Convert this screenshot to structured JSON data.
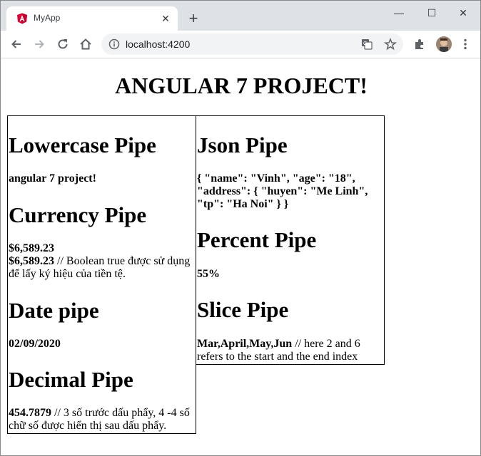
{
  "browser": {
    "tab_title": "MyApp",
    "url": "localhost:4200",
    "tab_close_glyph": "✕",
    "new_tab_glyph": "+",
    "window_minimize": "—",
    "window_maximize": "☐",
    "window_close": "✕",
    "angular_accent": "#dd0031"
  },
  "page": {
    "title": "ANGULAR 7 PROJECT!",
    "left": {
      "lowercase": {
        "heading": "Lowercase Pipe",
        "value": "angular 7 project!"
      },
      "currency": {
        "heading": "Currency Pipe",
        "value1": "$6,589.23",
        "value2": "$6,589.23",
        "comment": " // Boolean true được sử dụng để lấy ký hiệu của tiền tệ."
      },
      "date": {
        "heading": "Date pipe",
        "value": "02/09/2020"
      },
      "decimal": {
        "heading": "Decimal Pipe",
        "value": "454.7879",
        "comment": " // 3 số trước dấu phẩy, 4 -4 số chữ số được hiển thị sau dấu phẩy."
      }
    },
    "right": {
      "json": {
        "heading": "Json Pipe",
        "value": "{ \"name\": \"Vinh\", \"age\": \"18\", \"address\": { \"huyen\": \"Me Linh\", \"tp\": \"Ha Noi\" } }"
      },
      "percent": {
        "heading": "Percent Pipe",
        "value": "55%"
      },
      "slice": {
        "heading": "Slice Pipe",
        "value": "Mar,April,May,Jun",
        "comment": " // here 2 and 6 refers to the start and the end index"
      }
    }
  }
}
